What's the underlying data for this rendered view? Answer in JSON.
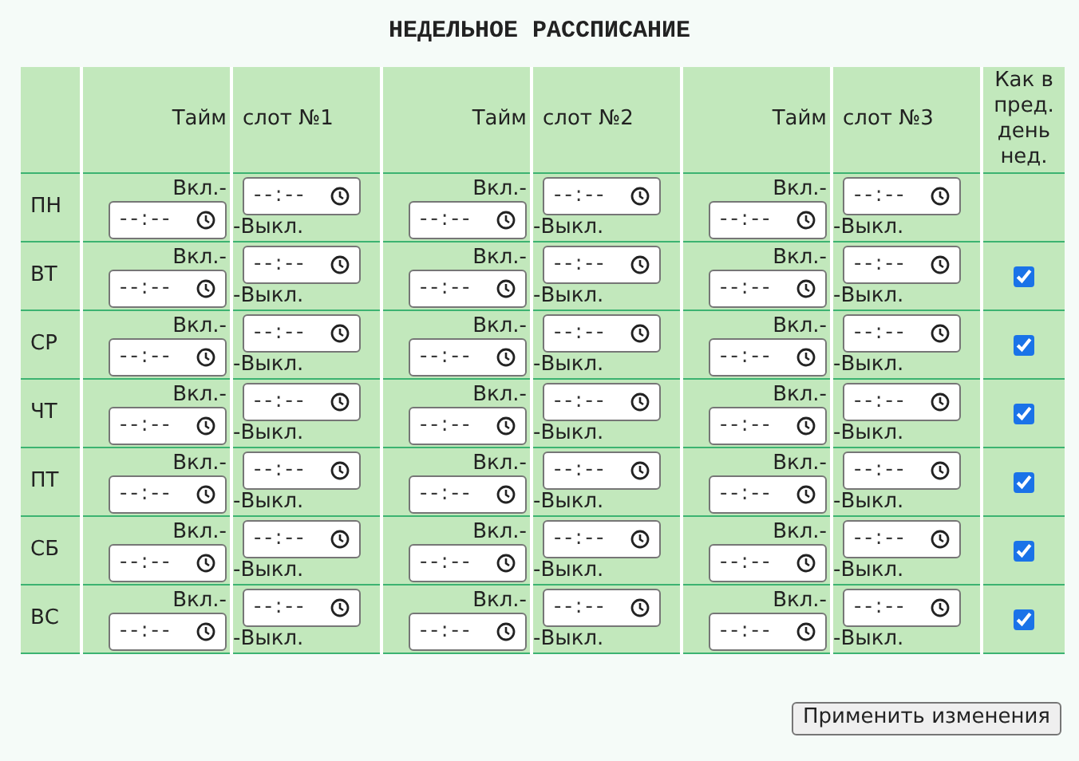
{
  "title": "НЕДЕЛЬНОЕ РАССПИСАНИЕ",
  "header": {
    "slots": [
      {
        "left": "Тайм",
        "right": "слот №1"
      },
      {
        "left": "Тайм",
        "right": "слот №2"
      },
      {
        "left": "Тайм",
        "right": "слот №3"
      }
    ],
    "last": "Как в пред. день нед."
  },
  "rows": [
    {
      "day": "ПН",
      "slots": [
        {
          "on": "Вкл.-",
          "on_placeholder": "--:--",
          "off_placeholder": "--:--",
          "off": "-Выкл."
        },
        {
          "on": "Вкл.-",
          "on_placeholder": "--:--",
          "off_placeholder": "--:--",
          "off": "-Выкл."
        },
        {
          "on": "Вкл.-",
          "on_placeholder": "--:--",
          "off_placeholder": "--:--",
          "off": "-Выкл."
        }
      ]
    },
    {
      "day": "ВТ",
      "slots": [
        {
          "on": "Вкл.-",
          "on_placeholder": "--:--",
          "off_placeholder": "--:--",
          "off": "-Выкл."
        },
        {
          "on": "Вкл.-",
          "on_placeholder": "--:--",
          "off_placeholder": "--:--",
          "off": "-Выкл."
        },
        {
          "on": "Вкл.-",
          "on_placeholder": "--:--",
          "off_placeholder": "--:--",
          "off": "-Выкл."
        }
      ],
      "same_as_previous": {
        "checked": true
      }
    },
    {
      "day": "СР",
      "slots": [
        {
          "on": "Вкл.-",
          "on_placeholder": "--:--",
          "off_placeholder": "--:--",
          "off": "-Выкл."
        },
        {
          "on": "Вкл.-",
          "on_placeholder": "--:--",
          "off_placeholder": "--:--",
          "off": "-Выкл."
        },
        {
          "on": "Вкл.-",
          "on_placeholder": "--:--",
          "off_placeholder": "--:--",
          "off": "-Выкл."
        }
      ],
      "same_as_previous": {
        "checked": true
      }
    },
    {
      "day": "ЧТ",
      "slots": [
        {
          "on": "Вкл.-",
          "on_placeholder": "--:--",
          "off_placeholder": "--:--",
          "off": "-Выкл."
        },
        {
          "on": "Вкл.-",
          "on_placeholder": "--:--",
          "off_placeholder": "--:--",
          "off": "-Выкл."
        },
        {
          "on": "Вкл.-",
          "on_placeholder": "--:--",
          "off_placeholder": "--:--",
          "off": "-Выкл."
        }
      ],
      "same_as_previous": {
        "checked": true
      }
    },
    {
      "day": "ПТ",
      "slots": [
        {
          "on": "Вкл.-",
          "on_placeholder": "--:--",
          "off_placeholder": "--:--",
          "off": "-Выкл."
        },
        {
          "on": "Вкл.-",
          "on_placeholder": "--:--",
          "off_placeholder": "--:--",
          "off": "-Выкл."
        },
        {
          "on": "Вкл.-",
          "on_placeholder": "--:--",
          "off_placeholder": "--:--",
          "off": "-Выкл."
        }
      ],
      "same_as_previous": {
        "checked": true
      }
    },
    {
      "day": "СБ",
      "slots": [
        {
          "on": "Вкл.-",
          "on_placeholder": "--:--",
          "off_placeholder": "--:--",
          "off": "-Выкл."
        },
        {
          "on": "Вкл.-",
          "on_placeholder": "--:--",
          "off_placeholder": "--:--",
          "off": "-Выкл."
        },
        {
          "on": "Вкл.-",
          "on_placeholder": "--:--",
          "off_placeholder": "--:--",
          "off": "-Выкл."
        }
      ],
      "same_as_previous": {
        "checked": true
      }
    },
    {
      "day": "ВС",
      "slots": [
        {
          "on": "Вкл.-",
          "on_placeholder": "--:--",
          "off_placeholder": "--:--",
          "off": "-Выкл."
        },
        {
          "on": "Вкл.-",
          "on_placeholder": "--:--",
          "off_placeholder": "--:--",
          "off": "-Выкл."
        },
        {
          "on": "Вкл.-",
          "on_placeholder": "--:--",
          "off_placeholder": "--:--",
          "off": "-Выкл."
        }
      ],
      "same_as_previous": {
        "checked": true
      }
    }
  ],
  "apply_button": "Применить изменения"
}
